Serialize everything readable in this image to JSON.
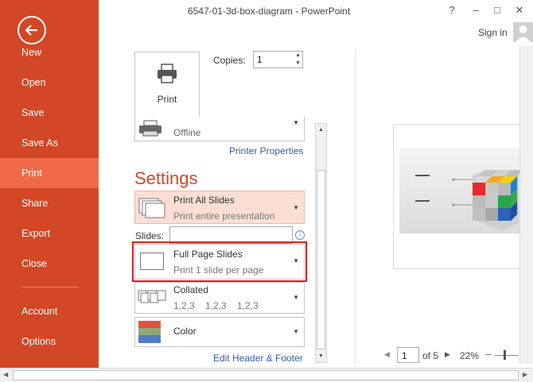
{
  "window": {
    "title": "6547-01-3d-box-diagram - PowerPoint",
    "help": "?",
    "minimize": "–",
    "maximize": "□",
    "close": "✕",
    "sign_in": "Sign in"
  },
  "sidebar": {
    "items": [
      {
        "label": "New"
      },
      {
        "label": "Open"
      },
      {
        "label": "Save"
      },
      {
        "label": "Save As"
      },
      {
        "label": "Print"
      },
      {
        "label": "Share"
      },
      {
        "label": "Export"
      },
      {
        "label": "Close"
      },
      {
        "label": "Account"
      },
      {
        "label": "Options"
      }
    ],
    "active": "Print",
    "color": "#d24726",
    "active_color": "#f06a47"
  },
  "print": {
    "button_label": "Print",
    "copies_label": "Copies:",
    "copies_value": "1",
    "printer_status": "Offline",
    "printer_properties": "Printer Properties",
    "settings_title": "Settings",
    "slides_label": "Slides:",
    "slides_value": "",
    "edit_header_footer": "Edit Header & Footer",
    "dropdowns": {
      "slides": {
        "main": "Print All Slides",
        "sub": "Print entire presentation"
      },
      "layout": {
        "main": "Full Page Slides",
        "sub": "Print 1 slide per page"
      },
      "collate": {
        "main": "Collated",
        "sub": "1,2,3    1,2,3    1,2,3"
      },
      "color": {
        "main": "Color"
      }
    }
  },
  "preview": {
    "page_number": "1",
    "page_total": "of 5",
    "zoom": "22%"
  },
  "colors": {
    "accent": "#d24726",
    "highlight_border": "#d81f1f",
    "link": "#2e5ea7"
  }
}
